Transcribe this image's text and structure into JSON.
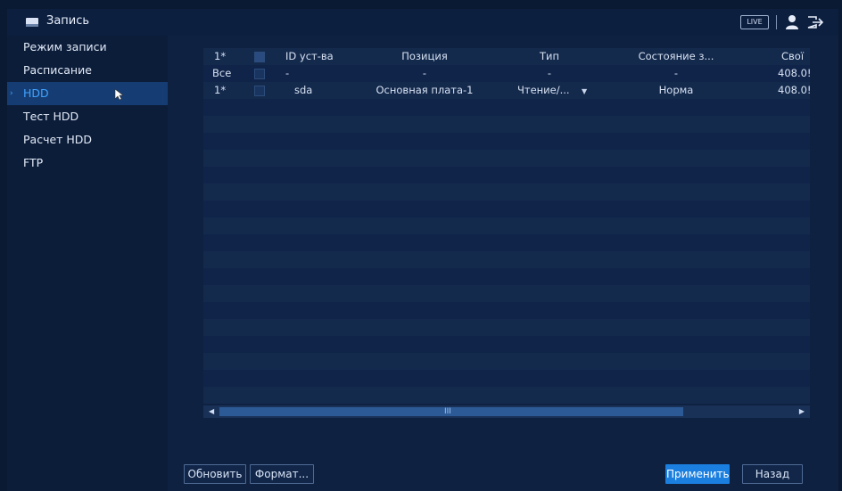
{
  "window": {
    "title": "Запись",
    "live_label": "LIVE"
  },
  "sidebar": {
    "items": [
      {
        "label": "Режим записи"
      },
      {
        "label": "Расписание"
      },
      {
        "label": "HDD",
        "active": true
      },
      {
        "label": "Тест HDD"
      },
      {
        "label": "Расчет HDD"
      },
      {
        "label": "FTP"
      }
    ]
  },
  "table": {
    "headers": [
      "1*",
      "ID уст-ва",
      "Позиция",
      "Тип",
      "Состояние з...",
      "Свої"
    ],
    "all_row": {
      "label": "Все",
      "device_id": "-",
      "position": "-",
      "type": "-",
      "state": "-",
      "free": "408.0!"
    },
    "rows": [
      {
        "index": "1*",
        "device_id": "sda",
        "position": "Основная плата-1",
        "type": "Чтение/...",
        "state": "Норма",
        "free": "408.0!"
      }
    ],
    "scroll_grip": "III"
  },
  "buttons": {
    "refresh": "Обновить",
    "format": "Формат...",
    "apply": "Применить",
    "back": "Назад"
  },
  "colors": {
    "accent": "#1b7fe0",
    "active_text": "#3fa3ff",
    "background": "#0f2140"
  }
}
